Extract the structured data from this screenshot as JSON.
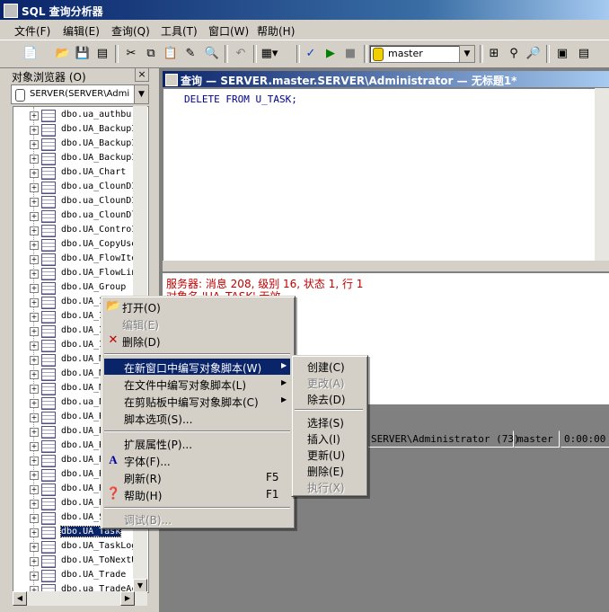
{
  "window": {
    "title": "SQL 查询分析器"
  },
  "menu": [
    "文件(F)",
    "编辑(E)",
    "查询(Q)",
    "工具(T)",
    "窗口(W)",
    "帮助(H)"
  ],
  "toolbar": {
    "database": "master",
    "icons": [
      "new-query-icon",
      "open-icon",
      "save-icon",
      "insert-template-icon",
      "cut-icon",
      "copy-icon",
      "paste-icon",
      "clear-icon",
      "find-icon",
      "undo-icon",
      "results-mode-icon",
      "parse-icon",
      "execute-icon",
      "stop-icon",
      "object-browser-icon",
      "object-search-icon",
      "properties-icon",
      "show-pane-icon"
    ]
  },
  "object_browser": {
    "title": "对象浏览器 (O)",
    "close": "×",
    "server": "SERVER(SERVER\\Admin",
    "items": [
      "dbo.ua_authbu",
      "dbo.UA_BackupI",
      "dbo.UA_BackupI",
      "dbo.UA_BackupI",
      "dbo.UA_Chart",
      "dbo.ua_ClounDI",
      "dbo.ua_ClounDI",
      "dbo.ua_ClounDl",
      "dbo.UA_ControI",
      "dbo.UA_CopyUse",
      "dbo.UA_FlowIte",
      "dbo.UA_FlowLin",
      "dbo.UA_Group",
      "dbo.UA_I",
      "dbo.UA_I",
      "dbo.UA_I",
      "dbo.UA_I",
      "dbo.UA_M",
      "dbo.UA_M",
      "dbo.UA_M",
      "dbo.ua_N",
      "dbo.UA_R",
      "dbo.UA_R",
      "dbo.UA_R",
      "dbo.UA_R",
      "dbo.UA_R",
      "dbo.UA_R",
      "dbo.UA_R",
      "dbo.UA_S",
      "dbo.UA_Task",
      "dbo.UA_TaskLog",
      "dbo.UA_ToNextU",
      "dbo.UA_Trade",
      "dbo.ua_TradeAc"
    ],
    "selected_index": 29
  },
  "query_window": {
    "title": "查询 — SERVER.master.SERVER\\Administrator — 无标题1*",
    "code": "DELETE FROM U_TASK;",
    "error_line1": "服务器: 消息 208, 级别 16, 状态 1, 行 1",
    "error_line2": "对象名 'UA_TASK' 无效。",
    "status_user": "SERVER\\Administrator (73)",
    "status_db": "master",
    "status_time": "0:00:00"
  },
  "context_menu": {
    "open": "打开(O)",
    "edit": "编辑(E)",
    "delete": "删除(D)",
    "script_new_window": "在新窗口中编写对象脚本(W)",
    "script_file": "在文件中编写对象脚本(L)",
    "script_clipboard": "在剪贴板中编写对象脚本(C)",
    "script_options": "脚本选项(S)...",
    "extended_props": "扩展属性(P)...",
    "font": "字体(F)...",
    "refresh": "刷新(R)",
    "refresh_key": "F5",
    "help": "帮助(H)",
    "help_key": "F1",
    "debug": "调试(B)..."
  },
  "submenu": {
    "create": "创建(C)",
    "alter": "更改(A)",
    "drop": "除去(D)",
    "select": "选择(S)",
    "insert": "插入(I)",
    "update": "更新(U)",
    "remove": "删除(E)",
    "execute": "执行(X)"
  }
}
